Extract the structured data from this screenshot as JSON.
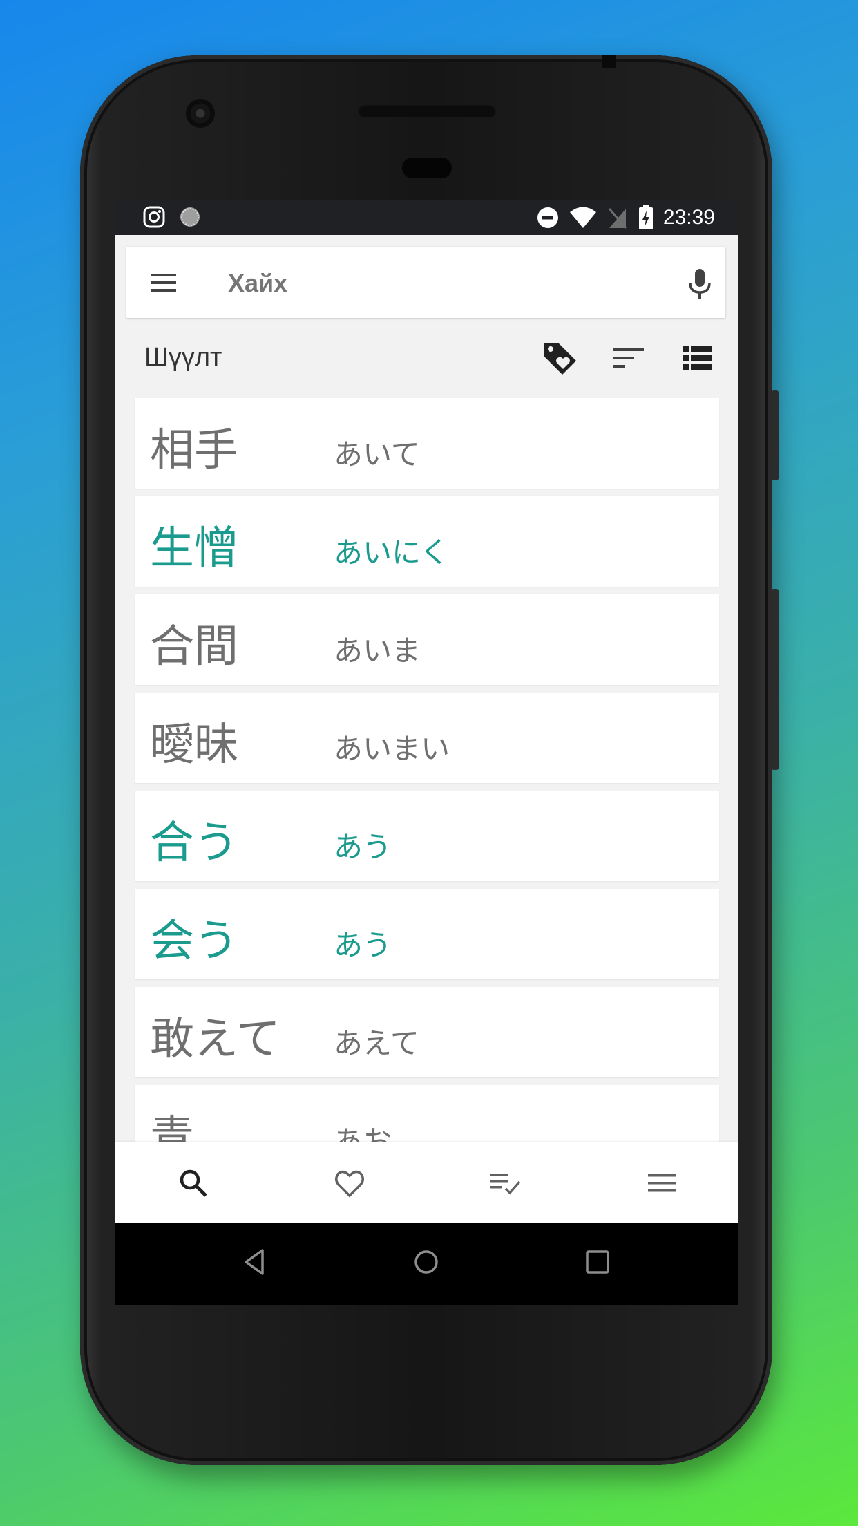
{
  "status_bar": {
    "time": "23:39",
    "left_icons": [
      "instagram-icon",
      "loading-icon"
    ],
    "right_icons": [
      "do-not-disturb-icon",
      "wifi-icon",
      "no-sim-icon",
      "battery-charging-icon"
    ]
  },
  "search": {
    "placeholder": "Хайх",
    "value": ""
  },
  "filter": {
    "label": "Шүүлт"
  },
  "words": [
    {
      "kanji": "相手",
      "reading": "あいて",
      "highlighted": false
    },
    {
      "kanji": "生憎",
      "reading": "あいにく",
      "highlighted": true
    },
    {
      "kanji": "合間",
      "reading": "あいま",
      "highlighted": false
    },
    {
      "kanji": "曖昧",
      "reading": "あいまい",
      "highlighted": false
    },
    {
      "kanji": "合う",
      "reading": "あう",
      "highlighted": true
    },
    {
      "kanji": "会う",
      "reading": "あう",
      "highlighted": true
    },
    {
      "kanji": "敢えて",
      "reading": "あえて",
      "highlighted": false
    },
    {
      "kanji": "青",
      "reading": "あお",
      "highlighted": false
    }
  ],
  "bottom_nav": [
    "search-icon",
    "heart-icon",
    "checklist-icon",
    "menu-icon"
  ],
  "colors": {
    "accent": "#1a9b8e",
    "text_gray": "#6f6f6f",
    "status_bar": "#202124"
  }
}
